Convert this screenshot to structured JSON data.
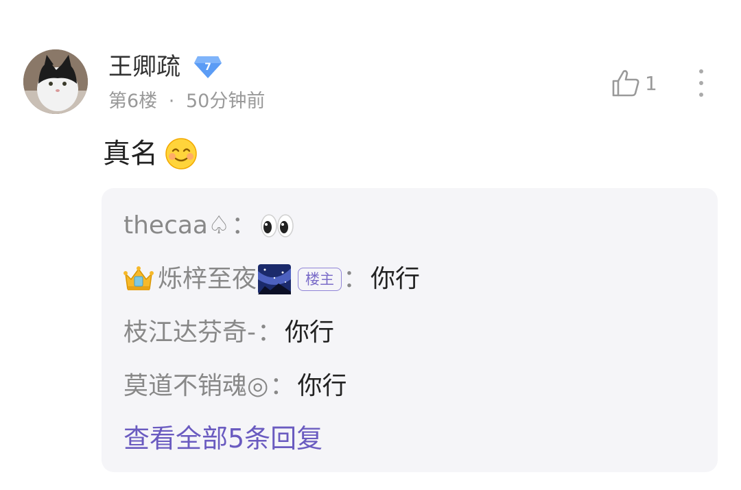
{
  "post": {
    "username": "王卿疏",
    "level": "7",
    "floor": "第6楼",
    "separator": "·",
    "time": "50分钟前",
    "like_count": "1",
    "content": "真名"
  },
  "replies": [
    {
      "name": "thecaa♤",
      "separator": "：",
      "text": ""
    },
    {
      "name": "烁梓至夜",
      "tag": "楼主",
      "separator": "：",
      "text": "你行"
    },
    {
      "name": "枝江达芬奇-",
      "separator": "：",
      "text": "你行"
    },
    {
      "name": "莫道不销魂◎",
      "separator": "：",
      "text": "你行"
    }
  ],
  "view_all_label": "查看全部5条回复",
  "colors": {
    "accent": "#6a5bc0",
    "reply_bg": "#f5f5f8",
    "meta_text": "#999999",
    "badge_blue": "#5b9cf5"
  },
  "icons": [
    "thumb-up-icon",
    "more-vertical-icon",
    "level-diamond-icon",
    "smile-emoji-icon",
    "eyes-emoji-icon",
    "crown-emoji-icon",
    "night-sky-emoji-icon"
  ]
}
